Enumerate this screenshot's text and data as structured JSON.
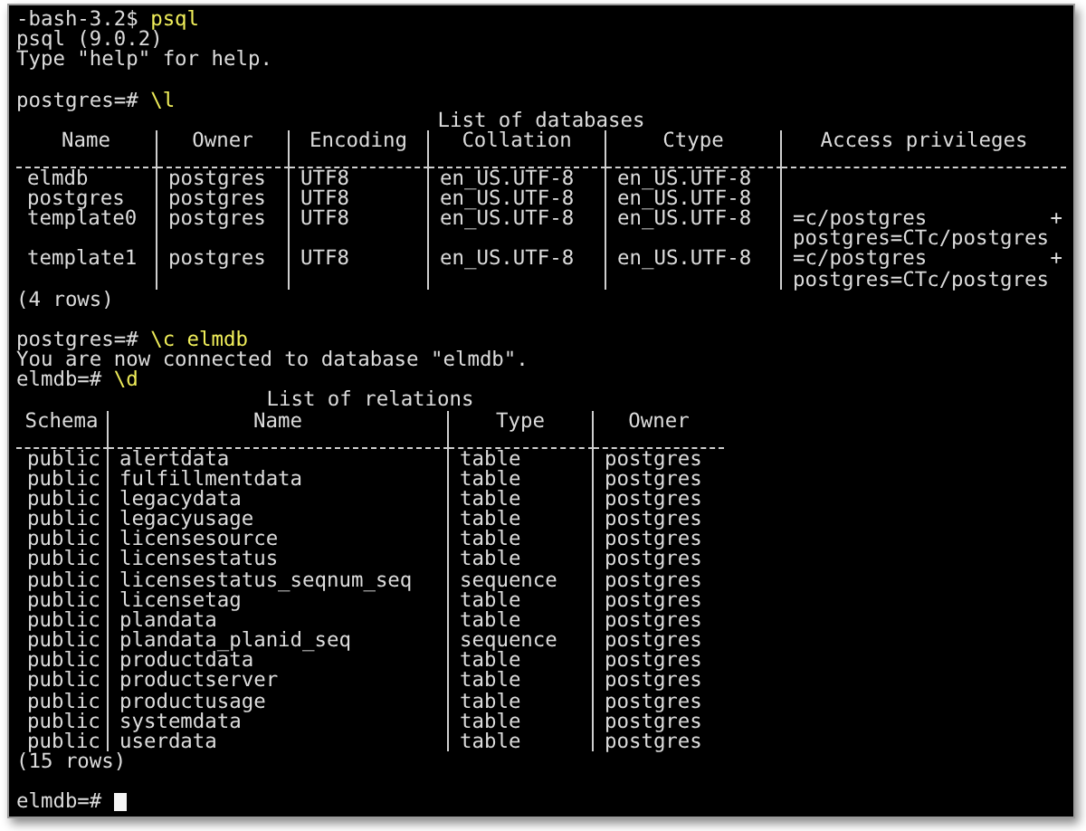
{
  "terminal": {
    "lines": [
      {
        "kind": "command",
        "prompt": "-bash-3.2$",
        "command": "psql"
      },
      {
        "kind": "output",
        "text": "psql (9.0.2)"
      },
      {
        "kind": "output",
        "text": "Type \"help\" for help."
      },
      {
        "kind": "blank"
      },
      {
        "kind": "command",
        "prompt": "postgres=#",
        "command": "\\l"
      },
      {
        "kind": "table",
        "title": "List of databases",
        "columns": [
          "Name",
          "Owner",
          "Encoding",
          "Collation",
          "Ctype",
          "Access privileges"
        ],
        "rows": [
          {
            "cells": [
              "elmdb",
              "postgres",
              "UTF8",
              "en_US.UTF-8",
              "en_US.UTF-8"
            ]
          },
          {
            "cells": [
              "postgres",
              "postgres",
              "UTF8",
              "en_US.UTF-8",
              "en_US.UTF-8"
            ]
          },
          {
            "cells": [
              "template0",
              "postgres",
              "UTF8",
              "en_US.UTF-8",
              "en_US.UTF-8",
              {
                "lines": [
                  {
                    "text": "=c/postgres",
                    "mark": "+"
                  },
                  {
                    "text": "postgres=CTc/postgres"
                  }
                ]
              }
            ]
          },
          {
            "cells": [
              "template1",
              "postgres",
              "UTF8",
              "en_US.UTF-8",
              "en_US.UTF-8",
              {
                "lines": [
                  {
                    "text": "=c/postgres",
                    "mark": "+"
                  },
                  {
                    "text": "postgres=CTc/postgres"
                  }
                ]
              }
            ]
          }
        ]
      },
      {
        "kind": "output",
        "text": "(4 rows)"
      },
      {
        "kind": "blank"
      },
      {
        "kind": "command",
        "prompt": "postgres=#",
        "command": "\\c elmdb"
      },
      {
        "kind": "output",
        "text": "You are now connected to database \"elmdb\"."
      },
      {
        "kind": "command",
        "prompt": "elmdb=#",
        "command": "\\d"
      },
      {
        "kind": "table",
        "title": "List of relations",
        "columns": [
          "Schema",
          "Name",
          "Type",
          "Owner"
        ],
        "rows": [
          {
            "cells": [
              "public",
              "alertdata",
              "table",
              "postgres"
            ]
          },
          {
            "cells": [
              "public",
              "fulfillmentdata",
              "table",
              "postgres"
            ]
          },
          {
            "cells": [
              "public",
              "legacydata",
              "table",
              "postgres"
            ]
          },
          {
            "cells": [
              "public",
              "legacyusage",
              "table",
              "postgres"
            ]
          },
          {
            "cells": [
              "public",
              "licensesource",
              "table",
              "postgres"
            ]
          },
          {
            "cells": [
              "public",
              "licensestatus",
              "table",
              "postgres"
            ]
          },
          {
            "cells": [
              "public",
              "licensestatus_seqnum_seq",
              "sequence",
              "postgres"
            ]
          },
          {
            "cells": [
              "public",
              "licensetag",
              "table",
              "postgres"
            ]
          },
          {
            "cells": [
              "public",
              "plandata",
              "table",
              "postgres"
            ]
          },
          {
            "cells": [
              "public",
              "plandata_planid_seq",
              "sequence",
              "postgres"
            ]
          },
          {
            "cells": [
              "public",
              "productdata",
              "table",
              "postgres"
            ]
          },
          {
            "cells": [
              "public",
              "productserver",
              "table",
              "postgres"
            ]
          },
          {
            "cells": [
              "public",
              "productusage",
              "table",
              "postgres"
            ]
          },
          {
            "cells": [
              "public",
              "systemdata",
              "table",
              "postgres"
            ]
          },
          {
            "cells": [
              "public",
              "userdata",
              "table",
              "postgres"
            ]
          }
        ]
      },
      {
        "kind": "output",
        "text": "(15 rows)"
      },
      {
        "kind": "blank"
      },
      {
        "kind": "prompt",
        "prompt": "elmdb=#"
      }
    ]
  }
}
